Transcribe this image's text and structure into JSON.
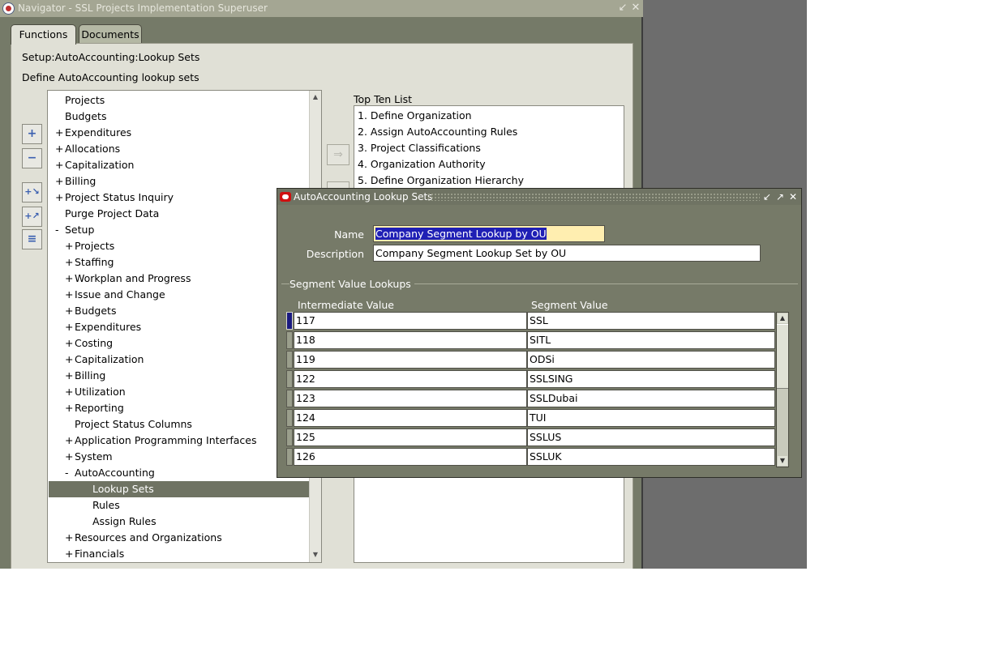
{
  "navigator": {
    "title": "Navigator - SSL Projects Implementation Superuser",
    "tabs": [
      {
        "label": "Functions",
        "active": true
      },
      {
        "label": "Documents",
        "active": false
      }
    ],
    "function_path": "Setup:AutoAccounting:Lookup Sets",
    "function_description": "Define AutoAccounting lookup sets",
    "top_ten_label": "Top Ten List",
    "tree": [
      {
        "toggle": "",
        "label": "Projects",
        "level": 0
      },
      {
        "toggle": "",
        "label": "Budgets",
        "level": 0
      },
      {
        "toggle": "+",
        "label": "Expenditures",
        "level": 0
      },
      {
        "toggle": "+",
        "label": "Allocations",
        "level": 0
      },
      {
        "toggle": "+",
        "label": "Capitalization",
        "level": 0
      },
      {
        "toggle": "+",
        "label": "Billing",
        "level": 0
      },
      {
        "toggle": "+",
        "label": "Project Status Inquiry",
        "level": 0
      },
      {
        "toggle": "",
        "label": "Purge Project Data",
        "level": 0
      },
      {
        "toggle": "-",
        "label": "Setup",
        "level": 0
      },
      {
        "toggle": "+",
        "label": "Projects",
        "level": 1
      },
      {
        "toggle": "+",
        "label": "Staffing",
        "level": 1
      },
      {
        "toggle": "+",
        "label": "Workplan and Progress",
        "level": 1
      },
      {
        "toggle": "+",
        "label": "Issue and Change",
        "level": 1
      },
      {
        "toggle": "+",
        "label": "Budgets",
        "level": 1
      },
      {
        "toggle": "+",
        "label": "Expenditures",
        "level": 1
      },
      {
        "toggle": "+",
        "label": "Costing",
        "level": 1
      },
      {
        "toggle": "+",
        "label": "Capitalization",
        "level": 1
      },
      {
        "toggle": "+",
        "label": "Billing",
        "level": 1
      },
      {
        "toggle": "+",
        "label": "Utilization",
        "level": 1
      },
      {
        "toggle": "+",
        "label": "Reporting",
        "level": 1
      },
      {
        "toggle": "",
        "label": "Project Status Columns",
        "level": 1
      },
      {
        "toggle": "+",
        "label": "Application Programming Interfaces",
        "level": 1
      },
      {
        "toggle": "+",
        "label": "System",
        "level": 1
      },
      {
        "toggle": "-",
        "label": "AutoAccounting",
        "level": 1
      },
      {
        "toggle": "",
        "label": "Lookup Sets",
        "level": 2,
        "selected": true
      },
      {
        "toggle": "",
        "label": "Rules",
        "level": 2
      },
      {
        "toggle": "",
        "label": "Assign Rules",
        "level": 2
      },
      {
        "toggle": "+",
        "label": "Resources and Organizations",
        "level": 1
      },
      {
        "toggle": "+",
        "label": "Financials",
        "level": 1
      }
    ],
    "top_ten": [
      "1. Define Organization",
      "2. Assign AutoAccounting Rules",
      "3. Project Classifications",
      "4. Organization Authority",
      "5. Define Organization Hierarchy"
    ],
    "side_buttons": [
      "expand-branch",
      "collapse-branch",
      "expand-all",
      "expand-all-branches",
      "collapse-all"
    ],
    "icons": {
      "minimize": "minimize-icon",
      "close": "close-icon"
    }
  },
  "dialog": {
    "title": "AutoAccounting Lookup Sets",
    "name_label": "Name",
    "name_value": "Company Segment Lookup by OU",
    "description_label": "Description",
    "description_value": "Company Segment Lookup Set by OU",
    "section_title": "Segment Value Lookups",
    "col_intermediate": "Intermediate Value",
    "col_segment": "Segment Value",
    "rows": [
      {
        "intermediate": "117",
        "segment": "SSL"
      },
      {
        "intermediate": "118",
        "segment": "SITL"
      },
      {
        "intermediate": "119",
        "segment": "ODSi"
      },
      {
        "intermediate": "122",
        "segment": "SSLSING"
      },
      {
        "intermediate": "123",
        "segment": "SSLDubai"
      },
      {
        "intermediate": "124",
        "segment": "TUI"
      },
      {
        "intermediate": "125",
        "segment": "SSLUS"
      },
      {
        "intermediate": "126",
        "segment": "SSLUK"
      }
    ],
    "colors": {
      "frame": "#767a68",
      "selection": "#1f1fb5",
      "required_field": "#ffeeb0"
    }
  }
}
